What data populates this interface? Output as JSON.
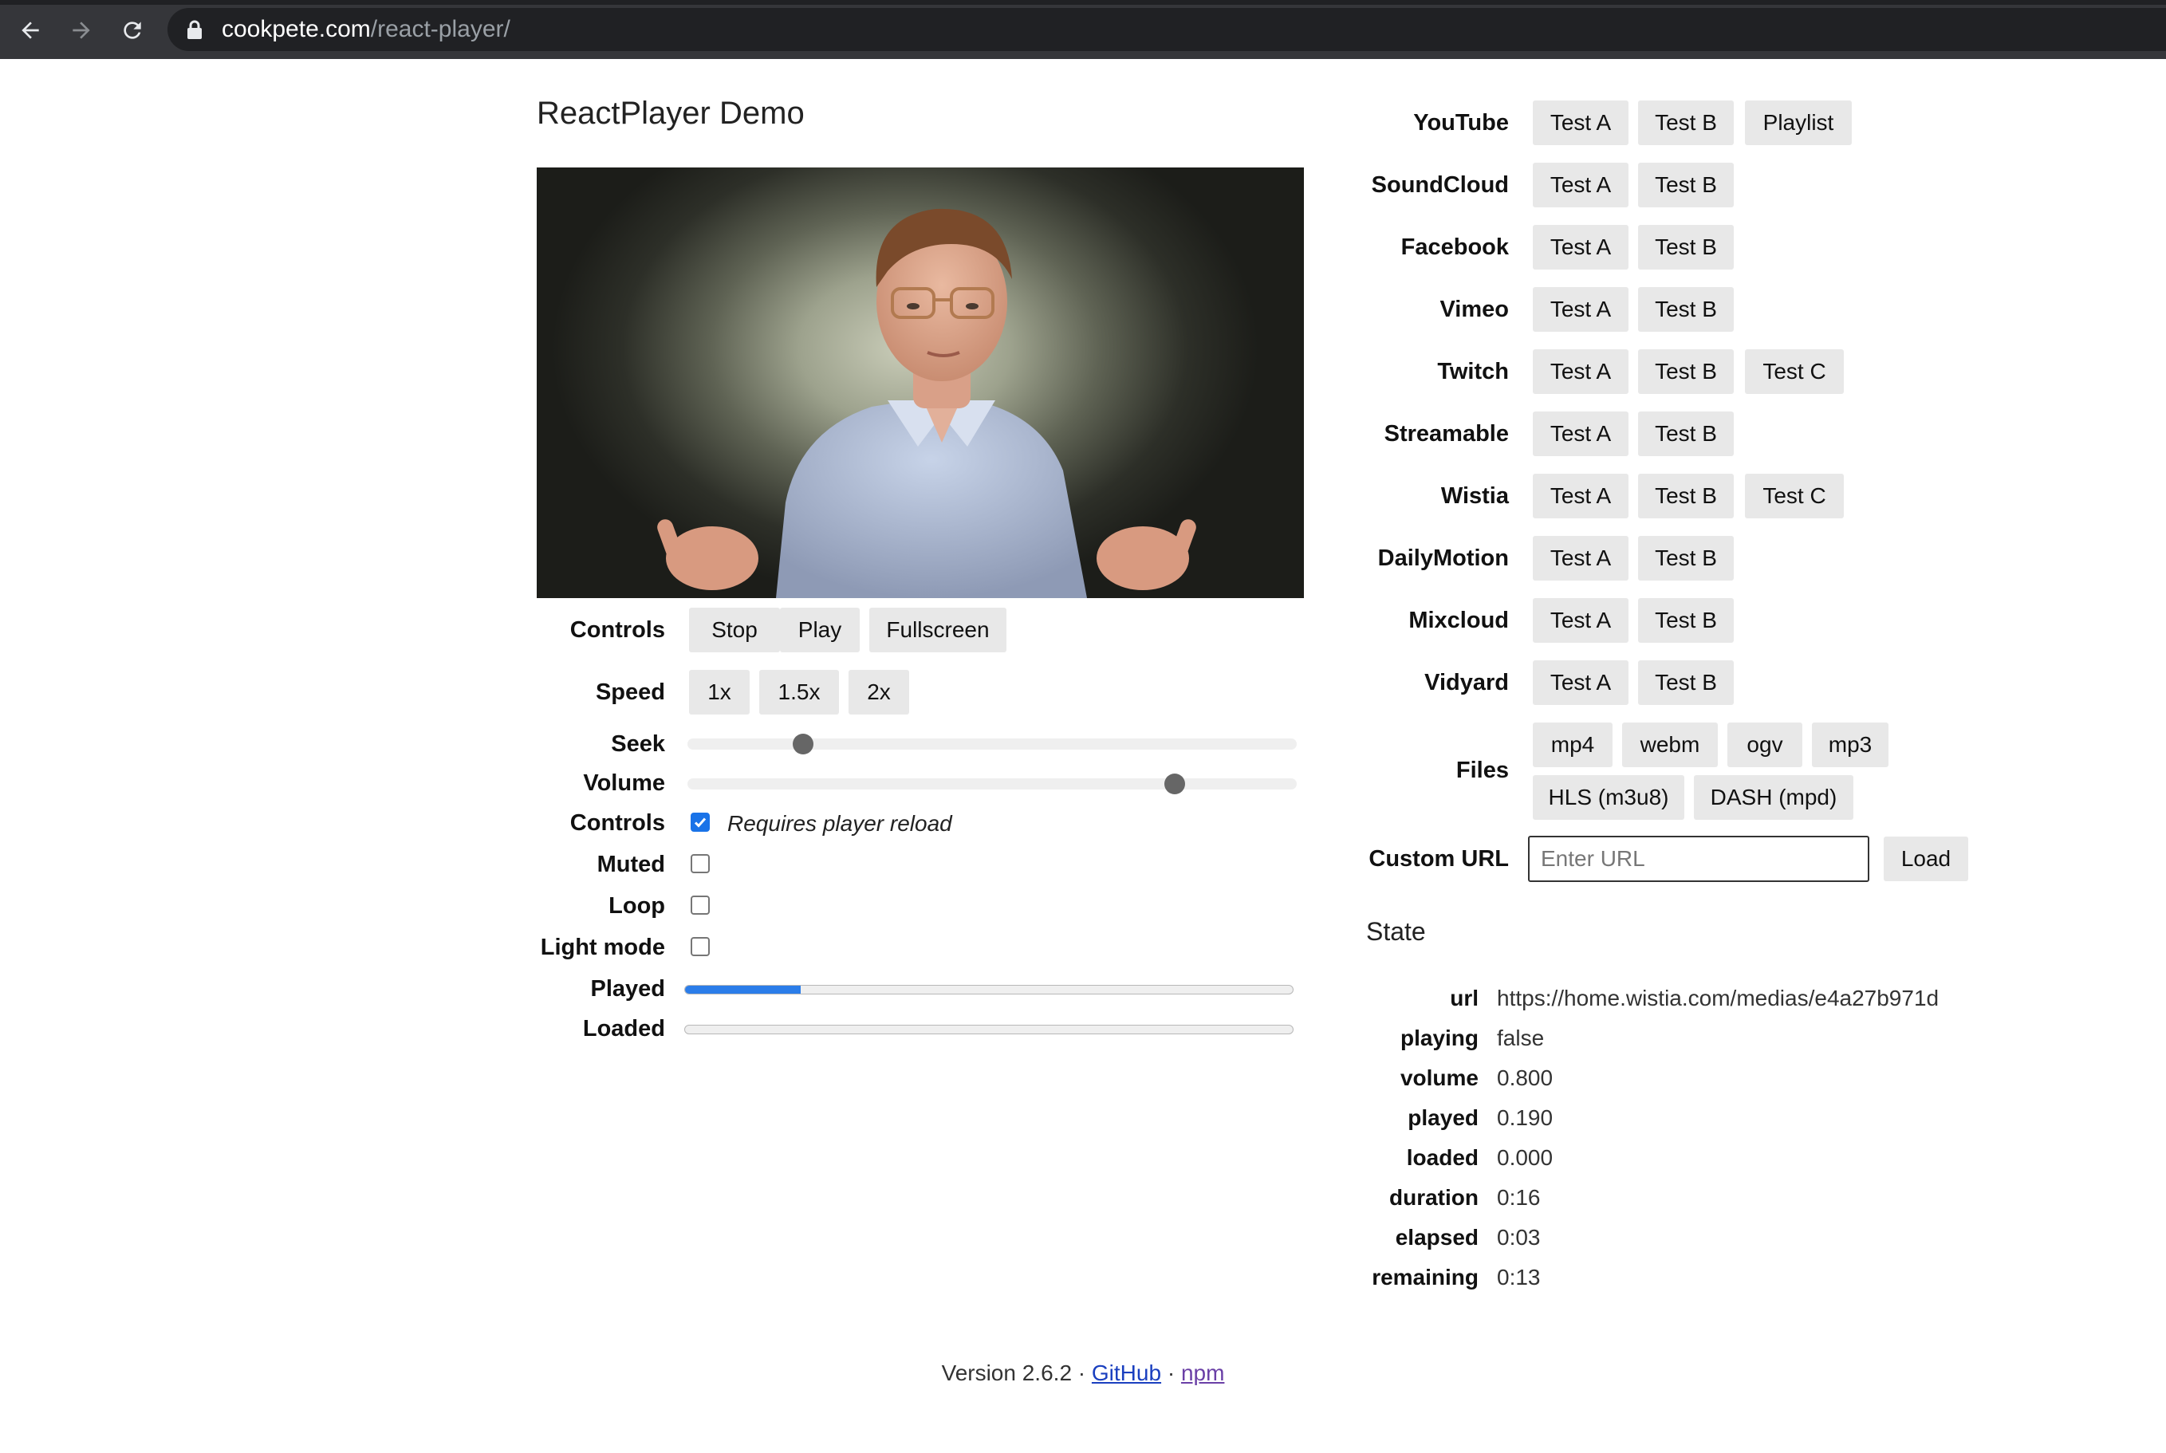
{
  "browser": {
    "url_host": "cookpete.com",
    "url_path": "/react-player/"
  },
  "page": {
    "title": "ReactPlayer Demo"
  },
  "controls": {
    "controls_label": "Controls",
    "stop": "Stop",
    "play": "Play",
    "fullscreen": "Fullscreen",
    "speed_label": "Speed",
    "speed_1x": "1x",
    "speed_15x": "1.5x",
    "speed_2x": "2x",
    "seek_label": "Seek",
    "seek_value": 0.19,
    "volume_label": "Volume",
    "volume_value": 0.8,
    "controls_check_label": "Controls",
    "controls_note": "Requires player reload",
    "controls_checked": true,
    "muted_label": "Muted",
    "muted_checked": false,
    "loop_label": "Loop",
    "loop_checked": false,
    "light_label": "Light mode",
    "light_checked": false,
    "played_label": "Played",
    "played_value": 0.19,
    "loaded_label": "Loaded",
    "loaded_value": 0.0
  },
  "sources": {
    "youtube": "YouTube",
    "soundcloud": "SoundCloud",
    "facebook": "Facebook",
    "vimeo": "Vimeo",
    "twitch": "Twitch",
    "streamable": "Streamable",
    "wistia": "Wistia",
    "dailymotion": "DailyMotion",
    "mixcloud": "Mixcloud",
    "vidyard": "Vidyard",
    "files": "Files",
    "test_a": "Test A",
    "test_b": "Test B",
    "test_c": "Test C",
    "playlist": "Playlist",
    "mp4": "mp4",
    "webm": "webm",
    "ogv": "ogv",
    "mp3": "mp3",
    "hls": "HLS (m3u8)",
    "dash": "DASH (mpd)",
    "custom_url_label": "Custom URL",
    "custom_url_placeholder": "Enter URL",
    "load": "Load"
  },
  "state": {
    "title": "State",
    "url_key": "url",
    "url_val": "https://home.wistia.com/medias/e4a27b971d",
    "playing_key": "playing",
    "playing_val": "false",
    "volume_key": "volume",
    "volume_val": "0.800",
    "played_key": "played",
    "played_val": "0.190",
    "loaded_key": "loaded",
    "loaded_val": "0.000",
    "duration_key": "duration",
    "duration_val": "0:16",
    "elapsed_key": "elapsed",
    "elapsed_val": "0:03",
    "remaining_key": "remaining",
    "remaining_val": "0:13"
  },
  "footer": {
    "version": "Version 2.6.2",
    "sep": "·",
    "github": "GitHub",
    "npm": "npm"
  },
  "colors": {
    "accent": "#2b7de9",
    "button_bg": "#e8e8e8",
    "chrome_bg": "#35363a"
  }
}
